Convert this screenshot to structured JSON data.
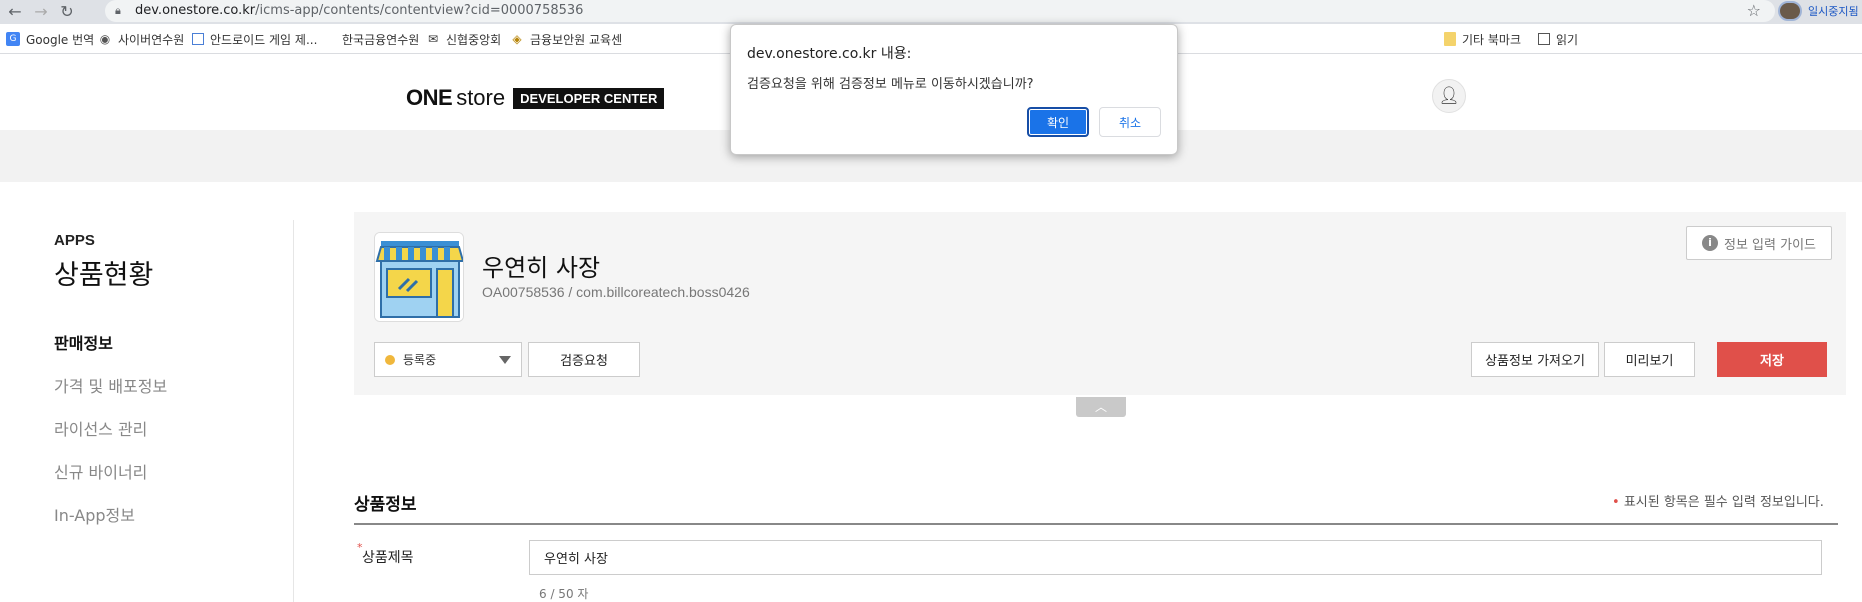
{
  "browser": {
    "url_host": "dev.onestore.co.kr",
    "url_path": "/icms-app/contents/contentview?cid=0000758536",
    "profile_label": "일시중지됨"
  },
  "bookmarks": [
    {
      "label": "Google 번역",
      "icon": "google-translate-icon"
    },
    {
      "label": "사이버연수원",
      "icon": "globe-icon"
    },
    {
      "label": "안드로이드 게임 제...",
      "icon": "page-icon"
    },
    {
      "label": "한국금융연수원",
      "icon": "page-icon"
    },
    {
      "label": "신협중앙회",
      "icon": "mail-icon"
    },
    {
      "label": "금융보안원 교육센",
      "icon": "diamond-icon"
    },
    {
      "label": "기타 북마크",
      "icon": "folder-icon"
    },
    {
      "label": "읽기",
      "icon": "reading-list-icon"
    }
  ],
  "header": {
    "logo_one": "ONE",
    "logo_store": "store",
    "logo_badge": "DEVELOPER CENTER"
  },
  "sidebar": {
    "section": "APPS",
    "title": "상품현황",
    "items": [
      {
        "label": "판매정보",
        "active": true
      },
      {
        "label": "가격 및 배포정보",
        "active": false
      },
      {
        "label": "라이선스 관리",
        "active": false
      },
      {
        "label": "신규 바이너리",
        "active": false
      },
      {
        "label": "In-App정보",
        "active": false
      }
    ]
  },
  "app": {
    "name": "우연히 사장",
    "sub": "OA00758536 / com.billcoreatech.boss0426",
    "guide_button": "정보 입력 가이드",
    "status": "등록중",
    "verify_button": "검증요청",
    "import_button": "상품정보 가져오기",
    "preview_button": "미리보기",
    "save_button": "저장",
    "status_color": "#f0b73c",
    "save_color": "#e0504a"
  },
  "section": {
    "title": "상품정보",
    "required_mark": "•",
    "required_note": "표시된 항목은 필수 입력 정보입니다.",
    "field_label": "상품제목",
    "field_required": "*",
    "field_value": "우연히 사장",
    "char_count": "6 / 50 자"
  },
  "dialog": {
    "title": "dev.onestore.co.kr 내용:",
    "message": "검증요청을 위해 검증정보 메뉴로 이동하시겠습니까?",
    "ok": "확인",
    "cancel": "취소"
  }
}
